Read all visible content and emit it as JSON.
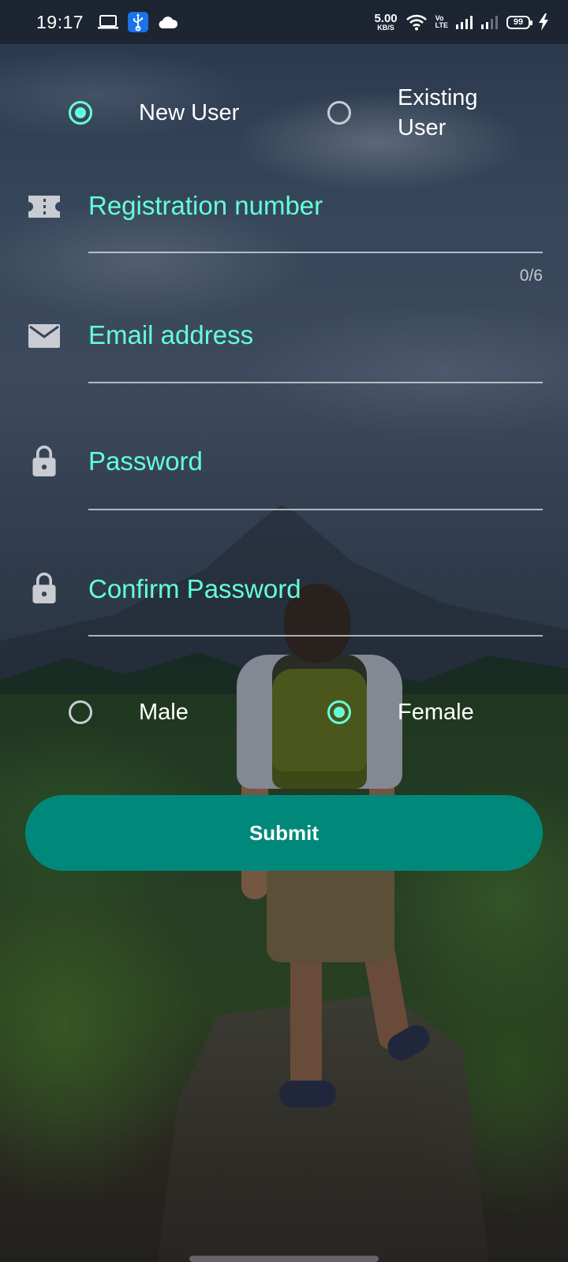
{
  "status_bar": {
    "time": "19:17",
    "net_speed_value": "5.00",
    "net_speed_unit": "KB/S",
    "volte_top": "Vo",
    "volte_bottom": "LTE",
    "battery": "99",
    "icons": [
      "laptop-icon",
      "usb-icon",
      "cloud-icon",
      "wifi-icon",
      "signal-icon",
      "signal-weak-icon",
      "charging-icon"
    ]
  },
  "user_type": {
    "options": [
      {
        "label": "New User",
        "selected": true
      },
      {
        "label": "Existing User",
        "selected": false
      }
    ]
  },
  "form": {
    "registration_placeholder": "Registration number",
    "registration_counter": "0/6",
    "email_placeholder": "Email address",
    "password_placeholder": "Password",
    "confirm_password_placeholder": "Confirm Password"
  },
  "gender": {
    "options": [
      {
        "label": "Male",
        "selected": false
      },
      {
        "label": "Female",
        "selected": true
      }
    ]
  },
  "submit_label": "Submit",
  "colors": {
    "accent": "#64ffda",
    "button": "#00897b",
    "text": "#ffffff"
  }
}
